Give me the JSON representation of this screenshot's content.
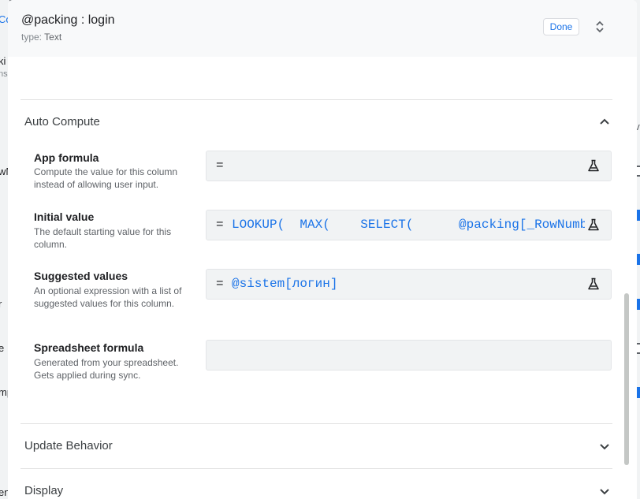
{
  "dialog": {
    "title": "@packing : login",
    "type_label": "type:",
    "type_value": "Text",
    "done_label": "Done"
  },
  "sections": {
    "auto_compute": "Auto Compute",
    "update_behavior": "Update Behavior",
    "display": "Display"
  },
  "fields": {
    "app_formula": {
      "label": "App formula",
      "description": "Compute the value for this column instead of allowing user input.",
      "eq": "=",
      "value": ""
    },
    "initial_value": {
      "label": "Initial value",
      "description": "The default starting value for this column.",
      "eq": "=",
      "value": "LOOKUP(  MAX(    SELECT(      @packing[_RowNumber]"
    },
    "suggested_values": {
      "label": "Suggested values",
      "description": "An optional expression with a list of suggested values for this column.",
      "eq": "=",
      "value": "@sistem[логин]"
    },
    "spreadsheet_formula": {
      "label": "Spreadsheet formula",
      "description": "Generated from your spreadsheet. Gets applied during sync.",
      "value": ""
    }
  },
  "background": {
    "left_fragments": [
      "Co",
      "ki",
      "ns",
      "wN",
      "r",
      "e",
      "mp",
      "en"
    ],
    "right_fragments": [
      "ov"
    ]
  },
  "icons": {
    "expand": "unfold-icon",
    "chevron_up": "chevron-up-icon",
    "chevron_down": "chevron-down-icon",
    "test": "flask-icon"
  },
  "colors": {
    "accent": "#1a73e8",
    "header_bg": "#f8f9fa",
    "field_bg": "#f1f3f4"
  }
}
